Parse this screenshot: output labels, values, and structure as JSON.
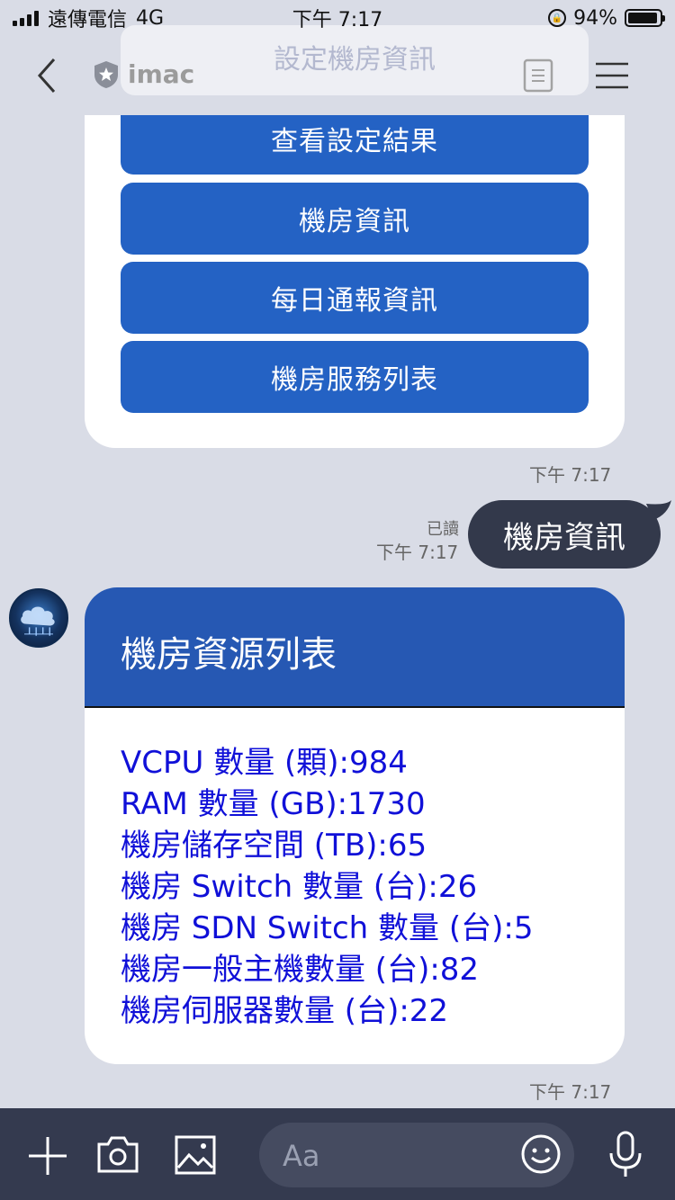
{
  "status_bar": {
    "carrier": "遠傳電信",
    "network": "4G",
    "time": "下午 7:17",
    "battery": "94%",
    "battery_level": 0.94
  },
  "nav": {
    "title": "imac"
  },
  "menu": {
    "ghost_label": "設定機房資訊",
    "buttons": [
      "查看設定結果",
      "機房資訊",
      "每日通報資訊",
      "機房服務列表"
    ],
    "timestamp": "下午 7:17"
  },
  "sent_message": {
    "read_label": "已讀",
    "time": "下午 7:17",
    "text": "機房資訊"
  },
  "flex_message": {
    "title": "機房資源列表",
    "lines": [
      "VCPU 數量 (顆):984",
      "RAM 數量 (GB):1730",
      "機房儲存空間 (TB):65",
      "機房 Switch 數量 (台):26",
      "機房 SDN Switch 數量 (台):5",
      "機房一般主機數量 (台):82",
      "機房伺服器數量 (台):22"
    ],
    "timestamp": "下午 7:17"
  },
  "input_bar": {
    "placeholder": "Aa"
  },
  "colors": {
    "background": "#d9dce6",
    "button_blue": "#2462c4",
    "header_blue": "#2658b3",
    "body_text": "#1010d8",
    "sent_bubble": "#33394b",
    "input_bar": "#343a4f"
  }
}
